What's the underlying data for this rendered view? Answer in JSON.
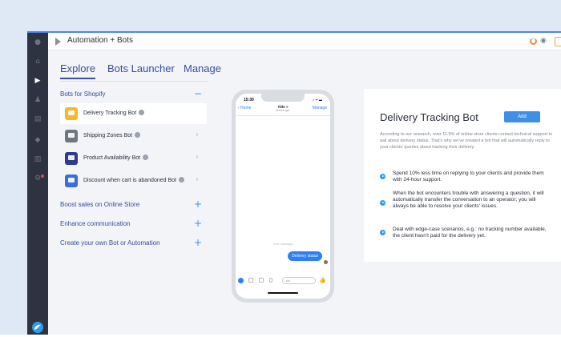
{
  "app": {
    "title": "Automation + Bots"
  },
  "tabs": [
    {
      "label": "Explore",
      "active": true
    },
    {
      "label": "Bots Launcher",
      "active": false
    },
    {
      "label": "Manage",
      "active": false
    }
  ],
  "sections": {
    "shopify": {
      "title": "Bots for Shopify",
      "sign": "−"
    },
    "boost": {
      "title": "Boost sales on Online Store",
      "sign": "+"
    },
    "enhance": {
      "title": "Enhance communication",
      "sign": "+"
    },
    "create": {
      "title": "Create your own Bot or Automation",
      "sign": "+"
    }
  },
  "bots": [
    {
      "label": "Delivery Tracking Bot",
      "icon_color": "#f5b82e",
      "active": true
    },
    {
      "label": "Shipping Zones Bot",
      "icon_color": "#6f7680",
      "active": false
    },
    {
      "label": "Product Availability Bot",
      "icon_color": "#2f3c8a",
      "active": false
    },
    {
      "label": "Discount when cart is abandoned Bot",
      "icon_color": "#3a6fd8",
      "active": false
    }
  ],
  "phone": {
    "time": "15:30",
    "status": "..l ᯤ ▬",
    "home": "‹ Home",
    "title": "Title >",
    "subtitle": "Messenger",
    "manage": "Manage",
    "hint": "Your message",
    "bubble": "Delivery status",
    "input_placeholder": "Aa"
  },
  "card": {
    "title": "Delivery Tracking Bot",
    "add_label": "Add",
    "description": "According to our research, over 11.5% of online store clients contact technical support to ask about delivery status. That's why we've created a bot that will automatically reply to your clients' queries about tracking their delivery.",
    "features": [
      "Spend 10% less time on replying to your clients and provide them with 24-hour support.",
      "When the bot encounters trouble with answering a question, it will automatically transfer the conversation to an operator; you will always be able to resolve your clients' issues.",
      "Deal with edge-case scenarios, e.g.: no tracking number available, the client hasn't paid for the delivery yet."
    ]
  },
  "colors": {
    "accent": "#3d8fe8",
    "nav_text": "#3a4ca0",
    "sidebar": "#2d3340"
  }
}
